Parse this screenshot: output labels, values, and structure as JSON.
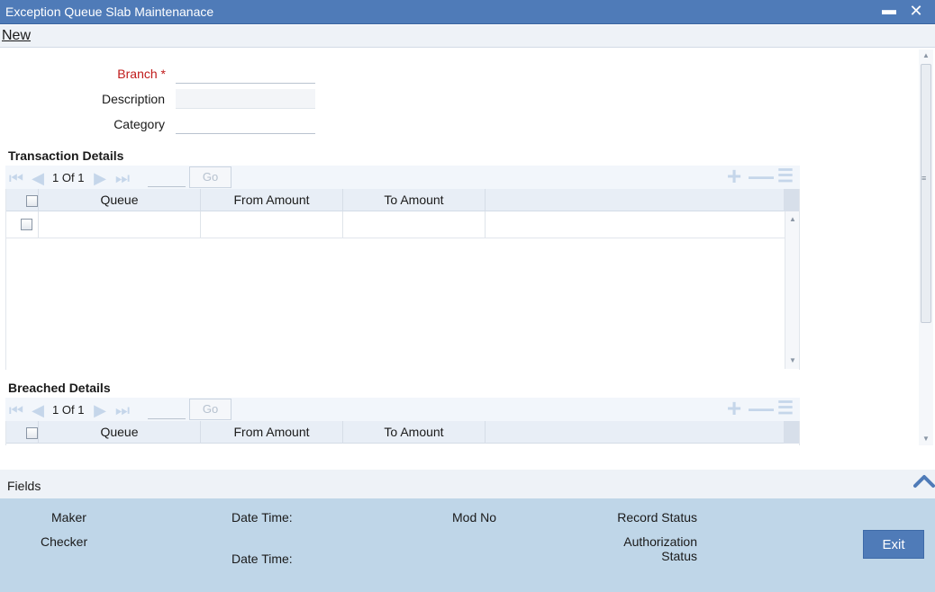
{
  "window": {
    "title": "Exception Queue Slab Maintenanace",
    "minimize_glyph": "▬",
    "close_glyph": "✕"
  },
  "menu": {
    "new_label": "New"
  },
  "form": {
    "branch_label": "Branch",
    "required_mark": "*",
    "description_label": "Description",
    "category_label": "Category",
    "branch_value": "",
    "description_value": "",
    "category_value": ""
  },
  "transaction_details": {
    "title": "Transaction Details",
    "pager": {
      "current": "1",
      "of_label": "Of",
      "total": "1",
      "go_label": "Go"
    },
    "columns": [
      "Queue",
      "From Amount",
      "To Amount"
    ],
    "rows": [
      {
        "queue": "",
        "from_amount": "",
        "to_amount": ""
      }
    ]
  },
  "breached_details": {
    "title": "Breached Details",
    "pager": {
      "current": "1",
      "of_label": "Of",
      "total": "1",
      "go_label": "Go"
    },
    "columns": [
      "Queue",
      "From Amount",
      "To Amount"
    ]
  },
  "fields_bar": {
    "label": "Fields"
  },
  "footer": {
    "maker_label": "Maker",
    "checker_label": "Checker",
    "date_time_label_1": "Date Time:",
    "date_time_label_2": "Date Time:",
    "mod_no_label": "Mod No",
    "record_status_label": "Record Status",
    "authorization_label": "Authorization",
    "status_label": "Status",
    "exit_label": "Exit"
  },
  "colors": {
    "titlebar": "#4f7bb8",
    "footer": "#bfd6e8",
    "required": "#c01a1a",
    "grid_header": "#e8eef6"
  },
  "icons": [
    "minimize-icon",
    "close-icon",
    "first-page-icon",
    "previous-page-icon",
    "next-page-icon",
    "last-page-icon",
    "add-row-icon",
    "delete-row-icon",
    "view-list-icon",
    "collapse-chevron-icon"
  ]
}
